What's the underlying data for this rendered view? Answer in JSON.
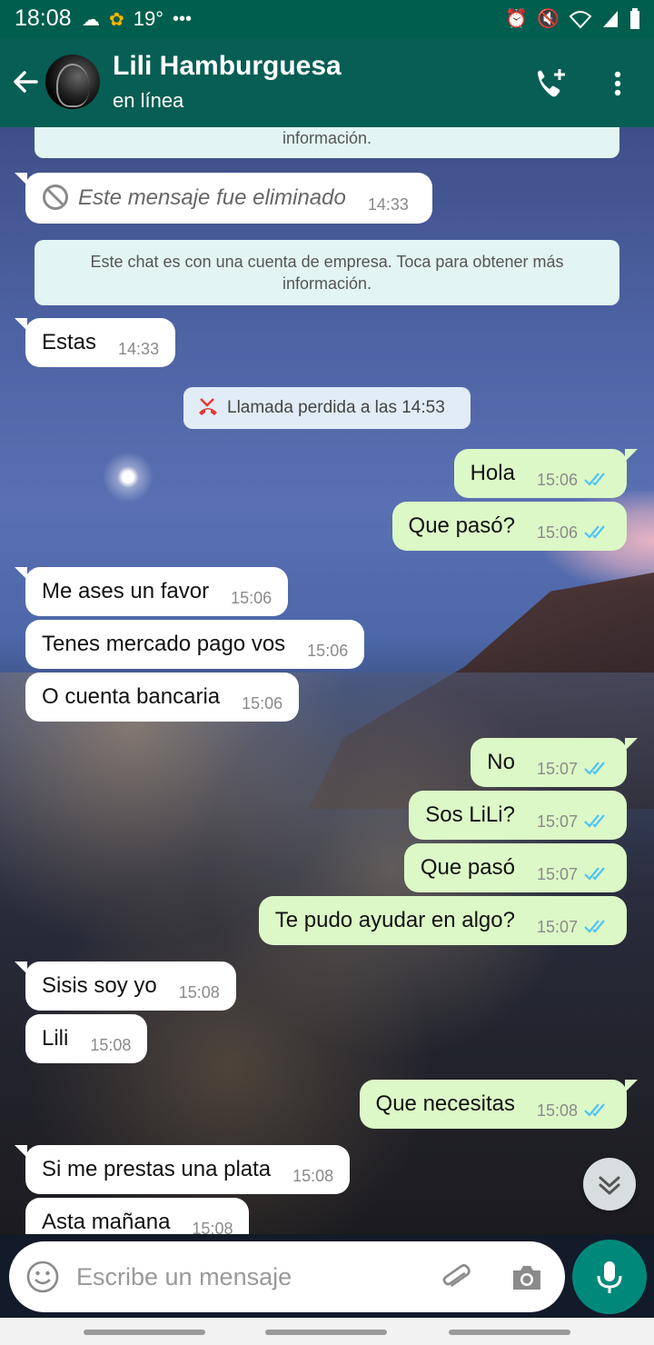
{
  "status_bar": {
    "time": "18:08",
    "temperature": "19°",
    "more": "•••"
  },
  "header": {
    "contact_name": "Lili Hamburguesa",
    "contact_status": "en línea"
  },
  "notices": {
    "partial": "información.",
    "business": "Este chat es con una cuenta de empresa. Toca para obtener más información."
  },
  "deleted_message": {
    "text": "Este mensaje fue eliminado",
    "time": "14:33"
  },
  "missed_call": "Llamada perdida a las 14:53",
  "messages": [
    {
      "text": "Estas",
      "time": "14:33",
      "dir": "in"
    },
    {
      "text": "Hola",
      "time": "15:06",
      "dir": "out"
    },
    {
      "text": "Que pasó?",
      "time": "15:06",
      "dir": "out"
    },
    {
      "text": "Me ases un favor",
      "time": "15:06",
      "dir": "in"
    },
    {
      "text": "Tenes mercado pago vos",
      "time": "15:06",
      "dir": "in"
    },
    {
      "text": "O cuenta bancaria",
      "time": "15:06",
      "dir": "in"
    },
    {
      "text": "No",
      "time": "15:07",
      "dir": "out"
    },
    {
      "text": "Sos LiLi?",
      "time": "15:07",
      "dir": "out"
    },
    {
      "text": "Que pasó",
      "time": "15:07",
      "dir": "out"
    },
    {
      "text": "Te pudo ayudar en algo?",
      "time": "15:07",
      "dir": "out"
    },
    {
      "text": "Sisis soy yo",
      "time": "15:08",
      "dir": "in"
    },
    {
      "text": "Lili",
      "time": "15:08",
      "dir": "in"
    },
    {
      "text": "Que necesitas",
      "time": "15:08",
      "dir": "out"
    },
    {
      "text": "Si me prestas una plata",
      "time": "15:08",
      "dir": "in"
    },
    {
      "text": "Asta mañana",
      "time": "15:08",
      "dir": "in"
    }
  ],
  "composer": {
    "placeholder": "Escribe un mensaje"
  },
  "colors": {
    "header": "#075e54",
    "outgoing_bubble": "#dcf8c6",
    "incoming_bubble": "#ffffff",
    "read_ticks": "#4fc3f7",
    "mic_button": "#00897b"
  }
}
